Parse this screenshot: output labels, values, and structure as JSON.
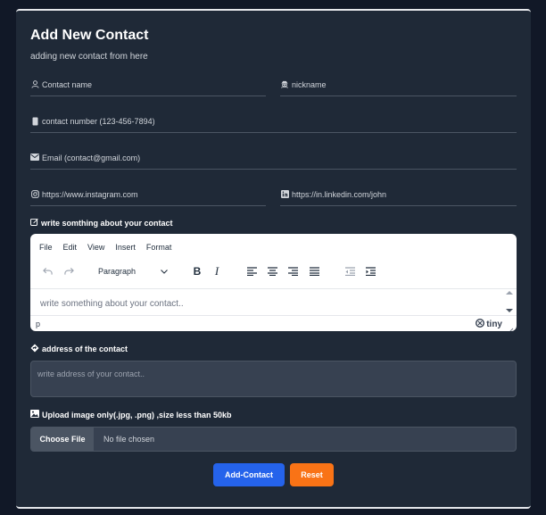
{
  "form": {
    "title": "Add New Contact",
    "subtitle": "adding new contact from here",
    "fields": {
      "name": {
        "placeholder": "Contact name",
        "icon": "user-icon"
      },
      "nickname": {
        "placeholder": "nickname",
        "icon": "user-secret-icon"
      },
      "phone": {
        "placeholder": "contact number (123-456-7894)",
        "icon": "mobile-icon"
      },
      "email": {
        "placeholder": "Email (contact@gmail.com)",
        "icon": "envelope-icon"
      },
      "instagram": {
        "placeholder": "https://www.instagram.com",
        "icon": "instagram-icon"
      },
      "linkedin": {
        "placeholder": "https://in.linkedin.com/john",
        "icon": "linkedin-icon"
      }
    },
    "about": {
      "label": "write somthing about your contact",
      "icon": "edit-icon",
      "editor": {
        "menu": [
          "File",
          "Edit",
          "View",
          "Insert",
          "Format"
        ],
        "block_format": "Paragraph",
        "placeholder": "write something about your contact..",
        "path": "p",
        "brand": "tiny"
      }
    },
    "address": {
      "label": "address of the contact",
      "icon": "location-diamond-icon",
      "placeholder": "write address of your contact.."
    },
    "upload": {
      "label": "Upload image only(.jpg, .png) ,size less than 50kb",
      "icon": "image-icon",
      "button": "Choose File",
      "status": "No file chosen"
    },
    "actions": {
      "submit": "Add-Contact",
      "reset": "Reset"
    }
  },
  "colors": {
    "page_bg": "#111827",
    "card_bg": "#1f2937",
    "submit": "#2563eb",
    "reset": "#f97316"
  }
}
